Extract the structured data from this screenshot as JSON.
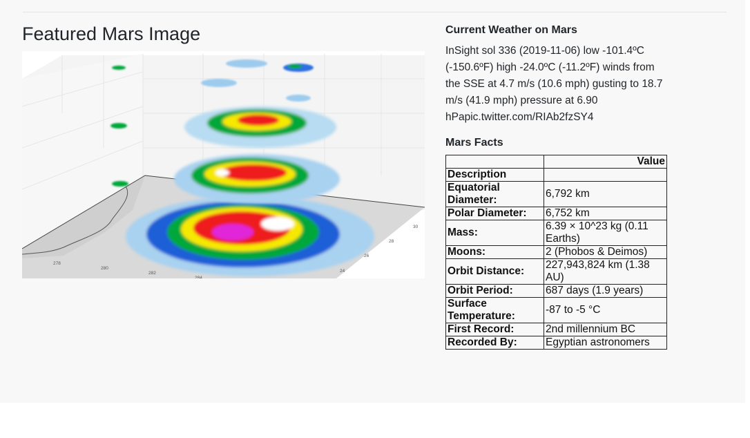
{
  "featured": {
    "title": "Featured Mars Image",
    "image_ticks": {
      "x": [
        "278",
        "280",
        "282",
        "284"
      ],
      "y": [
        "24",
        "26",
        "28",
        "30"
      ]
    }
  },
  "weather": {
    "heading": "Current Weather on Mars",
    "text": "InSight sol 336 (2019-11-06) low -101.4ºC (-150.6ºF) high -24.0ºC (-11.2ºF) winds from the SSE at 4.7 m/s (10.6 mph) gusting to 18.7 m/s (41.9 mph) pressure at 6.90 hPapic.twitter.com/RIAb2fzSY4"
  },
  "facts": {
    "heading": "Mars Facts",
    "header_value": "Value",
    "header_description": "Description",
    "rows": [
      {
        "label": "Equatorial Diameter:",
        "value": "6,792 km"
      },
      {
        "label": "Polar Diameter:",
        "value": "6,752 km"
      },
      {
        "label": "Mass:",
        "value": "6.39 × 10^23 kg (0.11 Earths)"
      },
      {
        "label": "Moons:",
        "value": "2 (Phobos & Deimos)"
      },
      {
        "label": "Orbit Distance:",
        "value": "227,943,824 km (1.38 AU)"
      },
      {
        "label": "Orbit Period:",
        "value": "687 days (1.9 years)"
      },
      {
        "label": "Surface Temperature:",
        "value": "-87 to -5 °C"
      },
      {
        "label": "First Record:",
        "value": "2nd millennium BC"
      },
      {
        "label": "Recorded By:",
        "value": "Egyptian astronomers"
      }
    ]
  },
  "colors": {
    "page_background": "#f8f8f8",
    "text": "#212529"
  }
}
